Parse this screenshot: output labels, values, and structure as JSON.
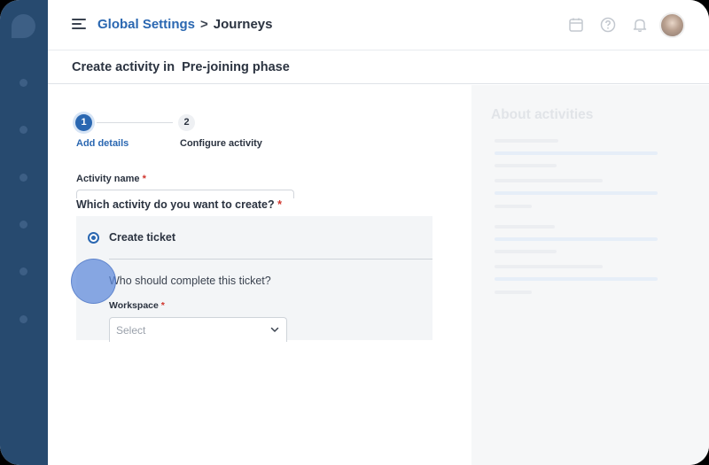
{
  "header": {
    "breadcrumb_link": "Global Settings",
    "breadcrumb_separator": ">",
    "breadcrumb_current": "Journeys",
    "icons": [
      "calendar-icon",
      "help-icon",
      "bell-icon"
    ]
  },
  "subheader": {
    "title": "Create activity in  Pre-joining phase"
  },
  "stepper": {
    "steps": [
      {
        "number": "1",
        "label": "Add details"
      },
      {
        "number": "2",
        "label": "Configure activity"
      }
    ]
  },
  "form": {
    "activity_name_label": "Activity name",
    "required_mark": "*",
    "question": "Which activity do you want to create?",
    "selected_option": "Create ticket",
    "sub_question": "Who should complete this ticket?",
    "workspace_label": "Workspace",
    "workspace_placeholder": "Select"
  },
  "right_panel": {
    "title": "About activities"
  },
  "colors": {
    "sidebar": "#274a6f",
    "accent": "#2a67b1",
    "required": "#d0342c"
  }
}
